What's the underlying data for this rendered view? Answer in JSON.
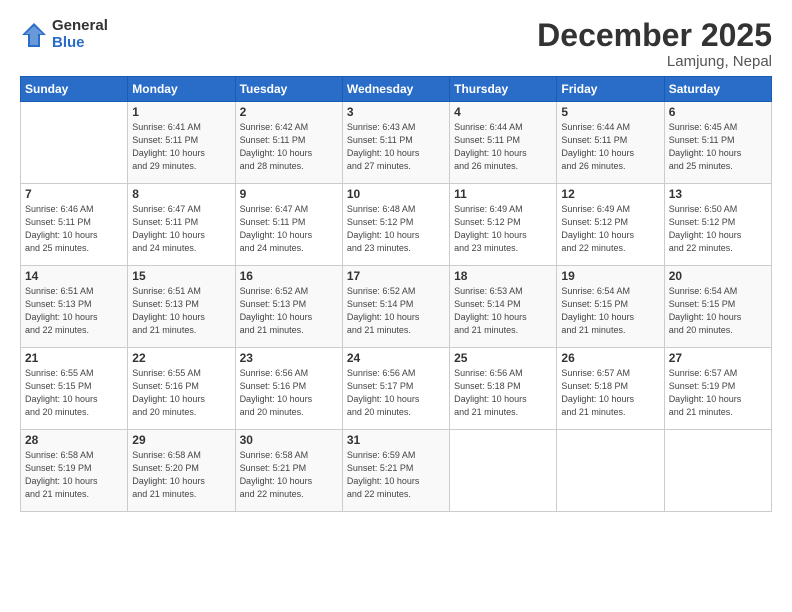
{
  "logo": {
    "general": "General",
    "blue": "Blue"
  },
  "title": "December 2025",
  "subtitle": "Lamjung, Nepal",
  "headers": [
    "Sunday",
    "Monday",
    "Tuesday",
    "Wednesday",
    "Thursday",
    "Friday",
    "Saturday"
  ],
  "weeks": [
    [
      {
        "day": "",
        "info": ""
      },
      {
        "day": "1",
        "info": "Sunrise: 6:41 AM\nSunset: 5:11 PM\nDaylight: 10 hours\nand 29 minutes."
      },
      {
        "day": "2",
        "info": "Sunrise: 6:42 AM\nSunset: 5:11 PM\nDaylight: 10 hours\nand 28 minutes."
      },
      {
        "day": "3",
        "info": "Sunrise: 6:43 AM\nSunset: 5:11 PM\nDaylight: 10 hours\nand 27 minutes."
      },
      {
        "day": "4",
        "info": "Sunrise: 6:44 AM\nSunset: 5:11 PM\nDaylight: 10 hours\nand 26 minutes."
      },
      {
        "day": "5",
        "info": "Sunrise: 6:44 AM\nSunset: 5:11 PM\nDaylight: 10 hours\nand 26 minutes."
      },
      {
        "day": "6",
        "info": "Sunrise: 6:45 AM\nSunset: 5:11 PM\nDaylight: 10 hours\nand 25 minutes."
      }
    ],
    [
      {
        "day": "7",
        "info": "Sunrise: 6:46 AM\nSunset: 5:11 PM\nDaylight: 10 hours\nand 25 minutes."
      },
      {
        "day": "8",
        "info": "Sunrise: 6:47 AM\nSunset: 5:11 PM\nDaylight: 10 hours\nand 24 minutes."
      },
      {
        "day": "9",
        "info": "Sunrise: 6:47 AM\nSunset: 5:11 PM\nDaylight: 10 hours\nand 24 minutes."
      },
      {
        "day": "10",
        "info": "Sunrise: 6:48 AM\nSunset: 5:12 PM\nDaylight: 10 hours\nand 23 minutes."
      },
      {
        "day": "11",
        "info": "Sunrise: 6:49 AM\nSunset: 5:12 PM\nDaylight: 10 hours\nand 23 minutes."
      },
      {
        "day": "12",
        "info": "Sunrise: 6:49 AM\nSunset: 5:12 PM\nDaylight: 10 hours\nand 22 minutes."
      },
      {
        "day": "13",
        "info": "Sunrise: 6:50 AM\nSunset: 5:12 PM\nDaylight: 10 hours\nand 22 minutes."
      }
    ],
    [
      {
        "day": "14",
        "info": "Sunrise: 6:51 AM\nSunset: 5:13 PM\nDaylight: 10 hours\nand 22 minutes."
      },
      {
        "day": "15",
        "info": "Sunrise: 6:51 AM\nSunset: 5:13 PM\nDaylight: 10 hours\nand 21 minutes."
      },
      {
        "day": "16",
        "info": "Sunrise: 6:52 AM\nSunset: 5:13 PM\nDaylight: 10 hours\nand 21 minutes."
      },
      {
        "day": "17",
        "info": "Sunrise: 6:52 AM\nSunset: 5:14 PM\nDaylight: 10 hours\nand 21 minutes."
      },
      {
        "day": "18",
        "info": "Sunrise: 6:53 AM\nSunset: 5:14 PM\nDaylight: 10 hours\nand 21 minutes."
      },
      {
        "day": "19",
        "info": "Sunrise: 6:54 AM\nSunset: 5:15 PM\nDaylight: 10 hours\nand 21 minutes."
      },
      {
        "day": "20",
        "info": "Sunrise: 6:54 AM\nSunset: 5:15 PM\nDaylight: 10 hours\nand 20 minutes."
      }
    ],
    [
      {
        "day": "21",
        "info": "Sunrise: 6:55 AM\nSunset: 5:15 PM\nDaylight: 10 hours\nand 20 minutes."
      },
      {
        "day": "22",
        "info": "Sunrise: 6:55 AM\nSunset: 5:16 PM\nDaylight: 10 hours\nand 20 minutes."
      },
      {
        "day": "23",
        "info": "Sunrise: 6:56 AM\nSunset: 5:16 PM\nDaylight: 10 hours\nand 20 minutes."
      },
      {
        "day": "24",
        "info": "Sunrise: 6:56 AM\nSunset: 5:17 PM\nDaylight: 10 hours\nand 20 minutes."
      },
      {
        "day": "25",
        "info": "Sunrise: 6:56 AM\nSunset: 5:18 PM\nDaylight: 10 hours\nand 21 minutes."
      },
      {
        "day": "26",
        "info": "Sunrise: 6:57 AM\nSunset: 5:18 PM\nDaylight: 10 hours\nand 21 minutes."
      },
      {
        "day": "27",
        "info": "Sunrise: 6:57 AM\nSunset: 5:19 PM\nDaylight: 10 hours\nand 21 minutes."
      }
    ],
    [
      {
        "day": "28",
        "info": "Sunrise: 6:58 AM\nSunset: 5:19 PM\nDaylight: 10 hours\nand 21 minutes."
      },
      {
        "day": "29",
        "info": "Sunrise: 6:58 AM\nSunset: 5:20 PM\nDaylight: 10 hours\nand 21 minutes."
      },
      {
        "day": "30",
        "info": "Sunrise: 6:58 AM\nSunset: 5:21 PM\nDaylight: 10 hours\nand 22 minutes."
      },
      {
        "day": "31",
        "info": "Sunrise: 6:59 AM\nSunset: 5:21 PM\nDaylight: 10 hours\nand 22 minutes."
      },
      {
        "day": "",
        "info": ""
      },
      {
        "day": "",
        "info": ""
      },
      {
        "day": "",
        "info": ""
      }
    ]
  ]
}
